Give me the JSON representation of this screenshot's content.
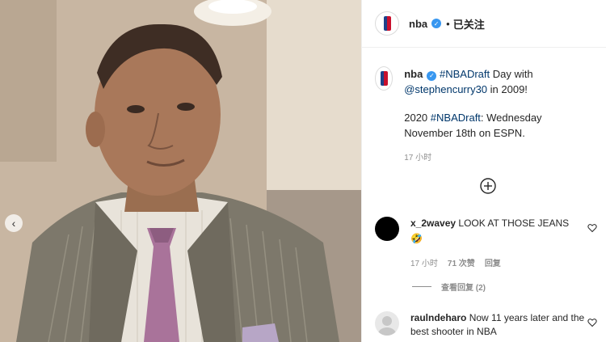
{
  "header": {
    "username": "nba",
    "separator": "•",
    "follow_label": "已关注"
  },
  "caption": {
    "username": "nba",
    "hashtag1": "#NBADraft",
    "text1": " Day with ",
    "mention": "@stephencurry30",
    "text2": " in 2009!",
    "line2_prefix": "2020 ",
    "hashtag2": "#NBADraft",
    "line2_rest": ": Wednesday November 18th on ESPN.",
    "time": "17 小时"
  },
  "comments": [
    {
      "username": "x_2wavey",
      "text": "LOOK AT THOSE JEANS",
      "emoji": "🤣",
      "time": "17 小时",
      "likes": "71 次赞",
      "reply_label": "回复",
      "view_replies": "查看回复 (2)"
    },
    {
      "username": "raulndeharo",
      "text": "Now 11 years later and the best shooter in NBA"
    }
  ],
  "icons": {
    "prev": "chevron-left-icon",
    "add": "add-circle-icon",
    "heart": "heart-icon",
    "verified": "verified-badge-icon"
  },
  "colors": {
    "link": "#00376b",
    "verified": "#3897f0",
    "muted": "#8e8e8e"
  }
}
